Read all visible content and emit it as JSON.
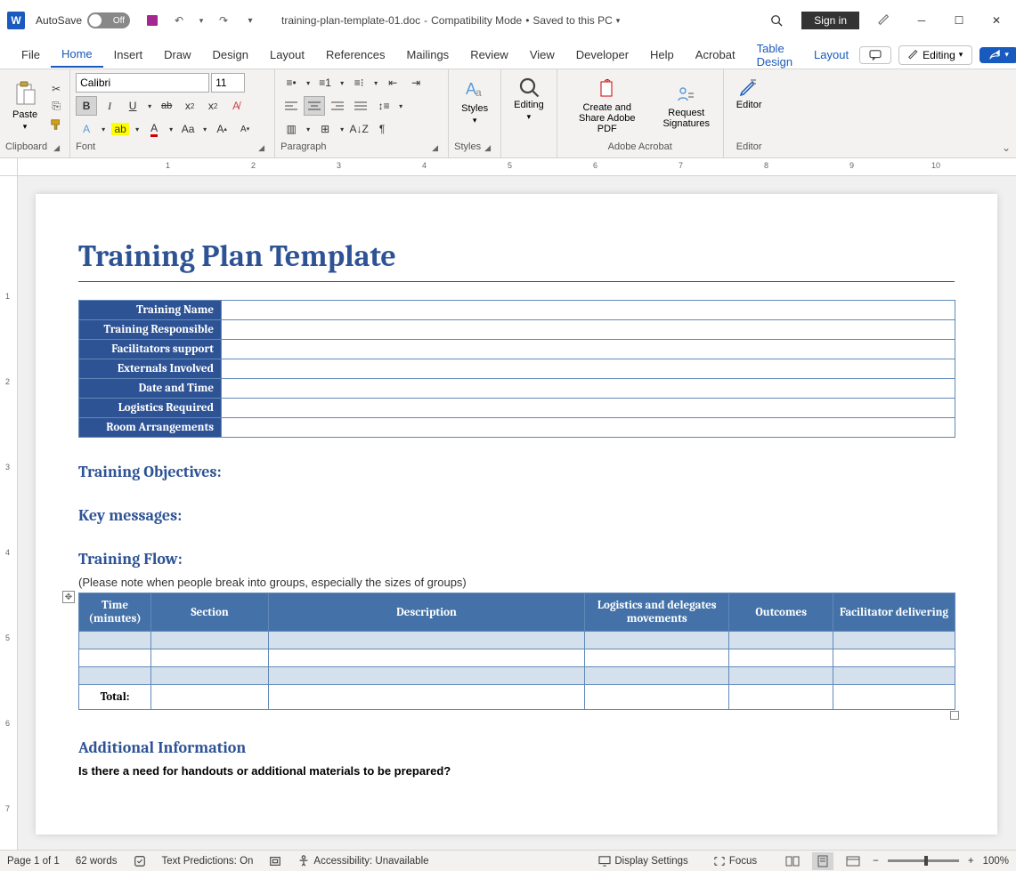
{
  "titlebar": {
    "autosave_label": "AutoSave",
    "autosave_state": "Off",
    "filename": "training-plan-template-01.doc",
    "sep": "-",
    "compat": "Compatibility Mode",
    "saved": "Saved to this PC",
    "signin": "Sign in"
  },
  "tabs": {
    "items": [
      "File",
      "Home",
      "Insert",
      "Draw",
      "Design",
      "Layout",
      "References",
      "Mailings",
      "Review",
      "View",
      "Developer",
      "Help",
      "Acrobat",
      "Table Design",
      "Layout"
    ],
    "active_index": 1,
    "editing": "Editing"
  },
  "ribbon": {
    "clipboard": {
      "paste": "Paste",
      "label": "Clipboard"
    },
    "font": {
      "name": "Calibri",
      "size": "11",
      "label": "Font"
    },
    "paragraph": {
      "label": "Paragraph"
    },
    "styles": {
      "btn": "Styles",
      "label": "Styles"
    },
    "editing": {
      "btn": "Editing"
    },
    "acrobat": {
      "create": "Create and Share Adobe PDF",
      "request": "Request Signatures",
      "label": "Adobe Acrobat"
    },
    "editor": {
      "btn": "Editor",
      "label": "Editor"
    }
  },
  "ruler_h": [
    "1",
    "2",
    "3",
    "4",
    "5",
    "6",
    "7",
    "8",
    "9",
    "10"
  ],
  "ruler_v": [
    "1",
    "2",
    "3",
    "4",
    "5",
    "6",
    "7"
  ],
  "document": {
    "title": "Training Plan Template",
    "info_rows": [
      "Training Name",
      "Training Responsible",
      "Facilitators support",
      "Externals Involved",
      "Date and Time",
      "Logistics Required",
      "Room Arrangements"
    ],
    "objectives_hdr": "Training Objectives:",
    "keymsg_hdr": "Key messages:",
    "flow_hdr": "Training Flow:",
    "flow_note": "(Please note when people break into groups, especially the sizes of groups)",
    "flow_cols": [
      "Time (minutes)",
      "Section",
      "Description",
      "Logistics and delegates movements",
      "Outcomes",
      "Facilitator delivering"
    ],
    "total_label": "Total:",
    "addl_hdr": "Additional Information",
    "addl_q": "Is there a need for handouts or additional materials to be prepared?"
  },
  "statusbar": {
    "page": "Page 1 of 1",
    "words": "62 words",
    "textpred": "Text Predictions: On",
    "accessibility": "Accessibility: Unavailable",
    "display": "Display Settings",
    "focus": "Focus",
    "zoom": "100%"
  }
}
